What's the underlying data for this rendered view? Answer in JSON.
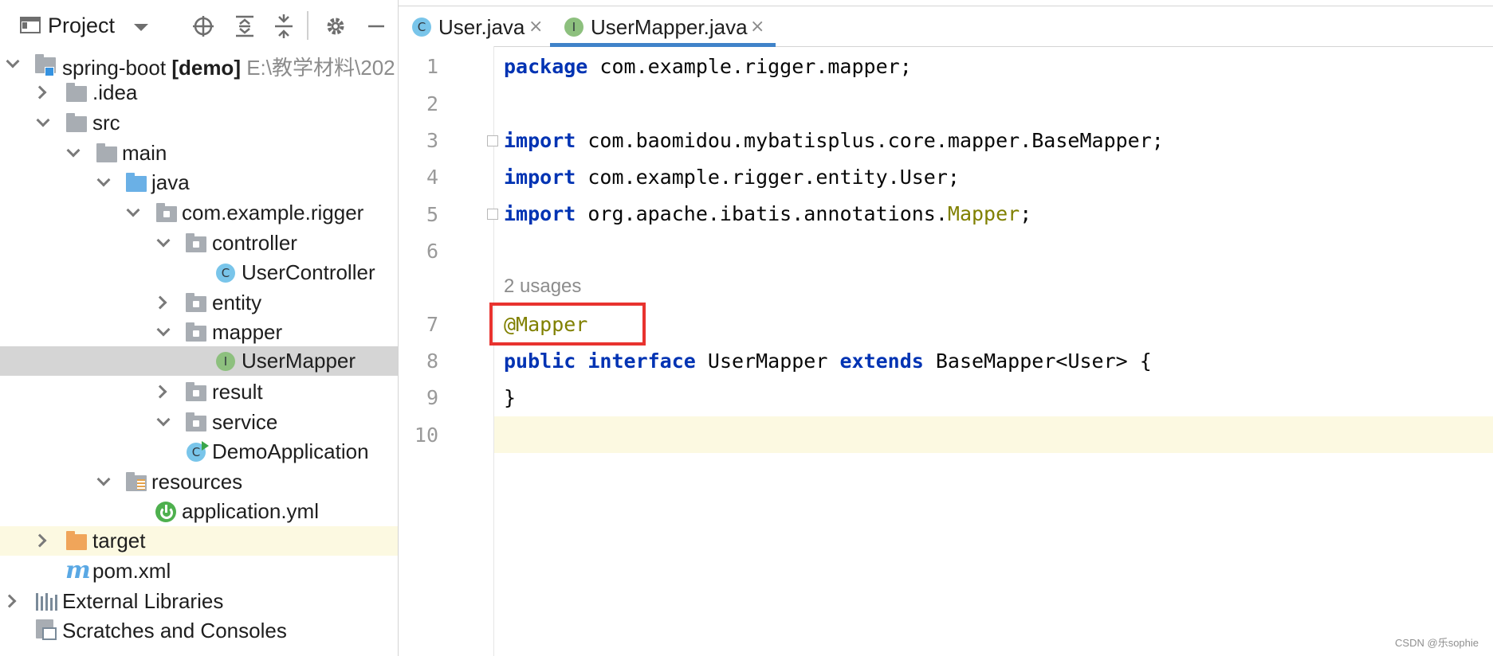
{
  "project_panel": {
    "title": "Project",
    "tree": [
      {
        "label": "spring-boot",
        "bold": "[demo]",
        "path": "E:\\教学材料\\202"
      },
      {
        "label": ".idea"
      },
      {
        "label": "src"
      },
      {
        "label": "main"
      },
      {
        "label": "java"
      },
      {
        "label": "com.example.rigger"
      },
      {
        "label": "controller"
      },
      {
        "label": "UserController"
      },
      {
        "label": "entity"
      },
      {
        "label": "mapper"
      },
      {
        "label": "UserMapper"
      },
      {
        "label": "result"
      },
      {
        "label": "service"
      },
      {
        "label": "DemoApplication"
      },
      {
        "label": "resources"
      },
      {
        "label": "application.yml"
      },
      {
        "label": "target"
      },
      {
        "label": "pom.xml"
      },
      {
        "label": "External Libraries"
      },
      {
        "label": "Scratches and Consoles"
      }
    ],
    "badges": {
      "class": "C",
      "interface": "I"
    }
  },
  "tabs": [
    {
      "label": "User.java",
      "close": "×",
      "active": false
    },
    {
      "label": "UserMapper.java",
      "close": "×",
      "active": true
    }
  ],
  "editor": {
    "line_numbers": [
      "1",
      "2",
      "3",
      "4",
      "5",
      "6",
      "7",
      "8",
      "9",
      "10"
    ],
    "inlay_hint": "2 usages",
    "lines": {
      "l1": {
        "kw": "package",
        "rest": " com.example.rigger.mapper;"
      },
      "l3": {
        "kw": "import",
        "rest": " com.baomidou.mybatisplus.core.mapper.BaseMapper;"
      },
      "l4": {
        "kw": "import",
        "rest": " com.example.rigger.entity.User;"
      },
      "l5": {
        "kw": "import",
        "rest": " org.apache.ibatis.annotations.",
        "ann": "Mapper",
        "end": ";"
      },
      "l7": {
        "ann": "@Mapper"
      },
      "l8": {
        "kw1": "public",
        "kw2": "interface",
        "name": " UserMapper ",
        "kw3": "extends",
        "rest": " BaseMapper<User> {"
      },
      "l9": {
        "text": "}"
      }
    }
  },
  "watermark": "CSDN @乐sophie",
  "colors": {
    "keyword": "#0033b3",
    "annotation": "#808000",
    "selection": "#d5d5d5",
    "current_line": "#fcf9e1",
    "highlight_box": "#e8332f",
    "tab_underline": "#4083c9"
  }
}
